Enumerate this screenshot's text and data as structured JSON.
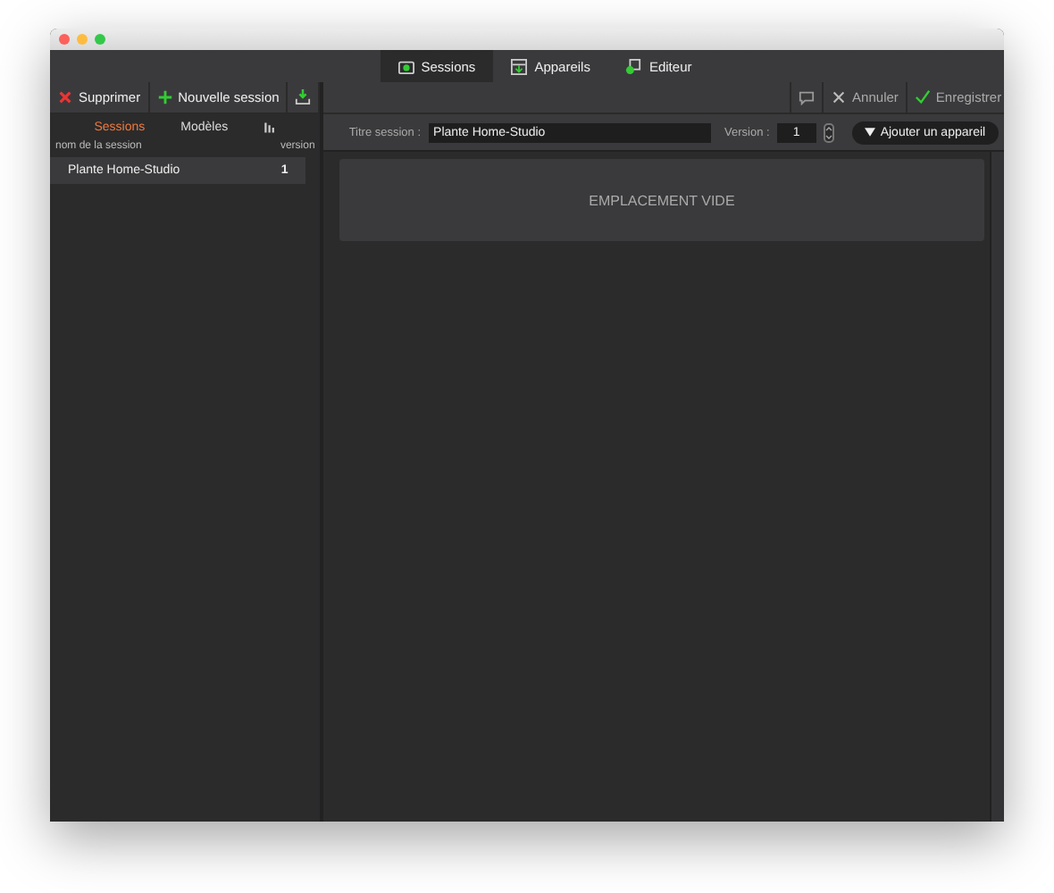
{
  "tabs": [
    {
      "label": "Sessions",
      "selected": true
    },
    {
      "label": "Appareils",
      "selected": false
    },
    {
      "label": "Editeur",
      "selected": false
    }
  ],
  "sidebar": {
    "toolbar": [
      {
        "kind": "delete",
        "label": "Supprimer"
      },
      {
        "kind": "add",
        "label": "Nouvelle session"
      },
      {
        "kind": "import"
      }
    ],
    "tabs": [
      {
        "kind": "text",
        "label": "Sessions",
        "selected": true
      },
      {
        "kind": "text",
        "label": "Modèles",
        "selected": false
      },
      {
        "kind": "icon",
        "selected": false
      }
    ],
    "columns": [
      "nom de la session",
      "version"
    ],
    "rows": [
      {
        "name": "Plante Home-Studio",
        "version": "1",
        "selected": true
      }
    ]
  },
  "editor": {
    "toolbar": [
      {
        "kind": "comment"
      },
      {
        "kind": "cancel",
        "label": "Annuler"
      },
      {
        "kind": "save",
        "label": "Enregistrer"
      }
    ],
    "title_label": "Titre session :",
    "title_value": "Plante Home-Studio",
    "version_label": "Version :",
    "version_value": "1",
    "add_button": "Ajouter un appareil",
    "slot": "EMPLACEMENT VIDE"
  }
}
